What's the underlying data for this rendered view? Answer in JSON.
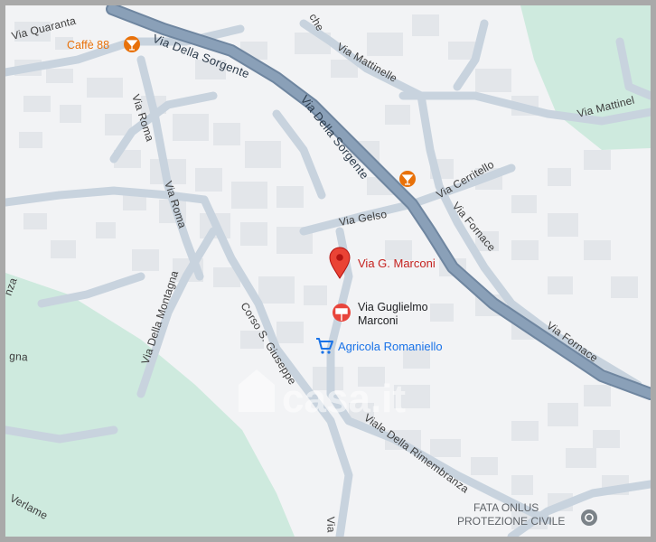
{
  "map": {
    "watermark": "casa.it",
    "colors": {
      "background": "#f2f3f5",
      "park": "#ceeade",
      "road": "#ffffff",
      "minor_road": "#c8d3de",
      "building": "#e3e6ea",
      "main_road": "#8aa0b8",
      "main_road_casing": "#6f86a0",
      "poi_orange": "#e8710a",
      "pin_red": "#ea4335",
      "shop_blue": "#1a73e8",
      "place_gray": "#5f6368"
    },
    "streets": {
      "via_della_sorgente_1": "Via Della Sorgente",
      "via_della_sorgente_2": "Via Della Sorgente",
      "via_mattinelle": "Via Mattinelle",
      "via_mattinel": "Via Mattinel",
      "via_roma_1": "Via Roma",
      "via_roma_2": "Via Roma",
      "via_quaranta": "Via Quaranta",
      "via_gelso": "Via Gelso",
      "via_cerritello": "Via Cerritello",
      "via_fornace_1": "Via Fornace",
      "via_fornace_2": "Via Fornace",
      "via_della_montagna": "Via Della Montagna",
      "corso_s_giuseppe": "Corso S. Giuseppe",
      "viale_della_rimembranza": "Viale Della Rimembranza",
      "verlame": "Verlame",
      "gna": "gna",
      "nza": "nza",
      "che": "che",
      "via_bottom": "Via"
    },
    "places": {
      "caffe_88": {
        "label": "Caffè 88",
        "icon": "cocktail-icon"
      },
      "bar_unnamed": {
        "icon": "cocktail-icon"
      },
      "via_g_marconi": {
        "label": "Via G. Marconi",
        "icon": "location-pin-icon"
      },
      "via_guglielmo_marconi": {
        "label_line1": "Via Guglielmo",
        "label_line2": "Marconi",
        "icon": "signpost-icon"
      },
      "agricola_romaniello": {
        "label": "Agricola Romaniello",
        "icon": "shopping-cart-icon"
      },
      "fata_onlus": {
        "label_line1": "FATA ONLUS",
        "label_line2": "PROTEZIONE CIVILE",
        "icon": "place-dot-icon"
      }
    }
  }
}
